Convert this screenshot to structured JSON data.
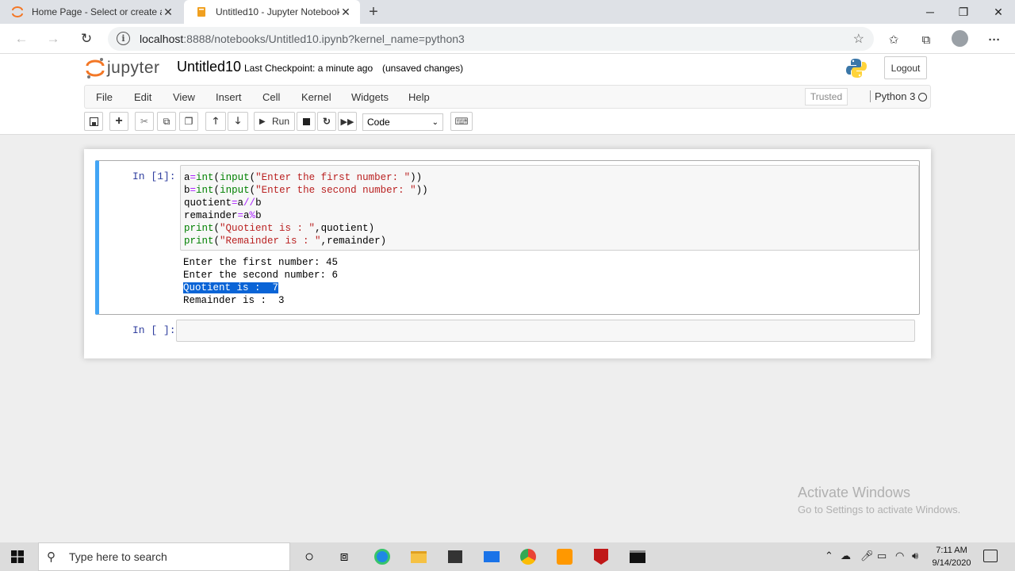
{
  "browser": {
    "tabs": [
      {
        "title": "Home Page - Select or create a n",
        "active": false
      },
      {
        "title": "Untitled10 - Jupyter Notebook",
        "active": true
      }
    ],
    "new_tab": "+",
    "url": "localhost:8888/notebooks/Untitled10.ipynb?kernel_name=python3",
    "url_host": "localhost",
    "url_rest": ":8888/notebooks/Untitled10.ipynb?kernel_name=python3"
  },
  "jupyter": {
    "logo_text": "jupyter",
    "notebook_name": "Untitled10",
    "checkpoint_label": "Last Checkpoint:",
    "checkpoint_time": "a minute ago",
    "save_status": "(unsaved changes)",
    "logout_label": "Logout",
    "menu": [
      "File",
      "Edit",
      "View",
      "Insert",
      "Cell",
      "Kernel",
      "Widgets",
      "Help"
    ],
    "trusted_label": "Trusted",
    "kernel_name": "Python 3",
    "toolbar": {
      "run_label": "Run",
      "cell_type": "Code"
    },
    "accent_color": "#42a5f5"
  },
  "cells": {
    "cell1": {
      "prompt": "In [1]:",
      "code_lines": [
        "a=int(input(\"Enter the first number: \"))",
        "b=int(input(\"Enter the second number: \"))",
        "quotient=a//b",
        "remainder=a%b",
        "print(\"Quotient is : \",quotient)",
        "print(\"Remainder is : \",remainder)"
      ],
      "output_lines": [
        "Enter the first number: 45",
        "Enter the second number: 6",
        "Quotient is :  7",
        "Remainder is :  3"
      ]
    },
    "cell2": {
      "prompt": "In [ ]:"
    }
  },
  "watermark": {
    "line1": "Activate Windows",
    "line2": "Go to Settings to activate Windows."
  },
  "taskbar": {
    "search_placeholder": "Type here to search",
    "time": "7:11 AM",
    "date": "9/14/2020"
  }
}
